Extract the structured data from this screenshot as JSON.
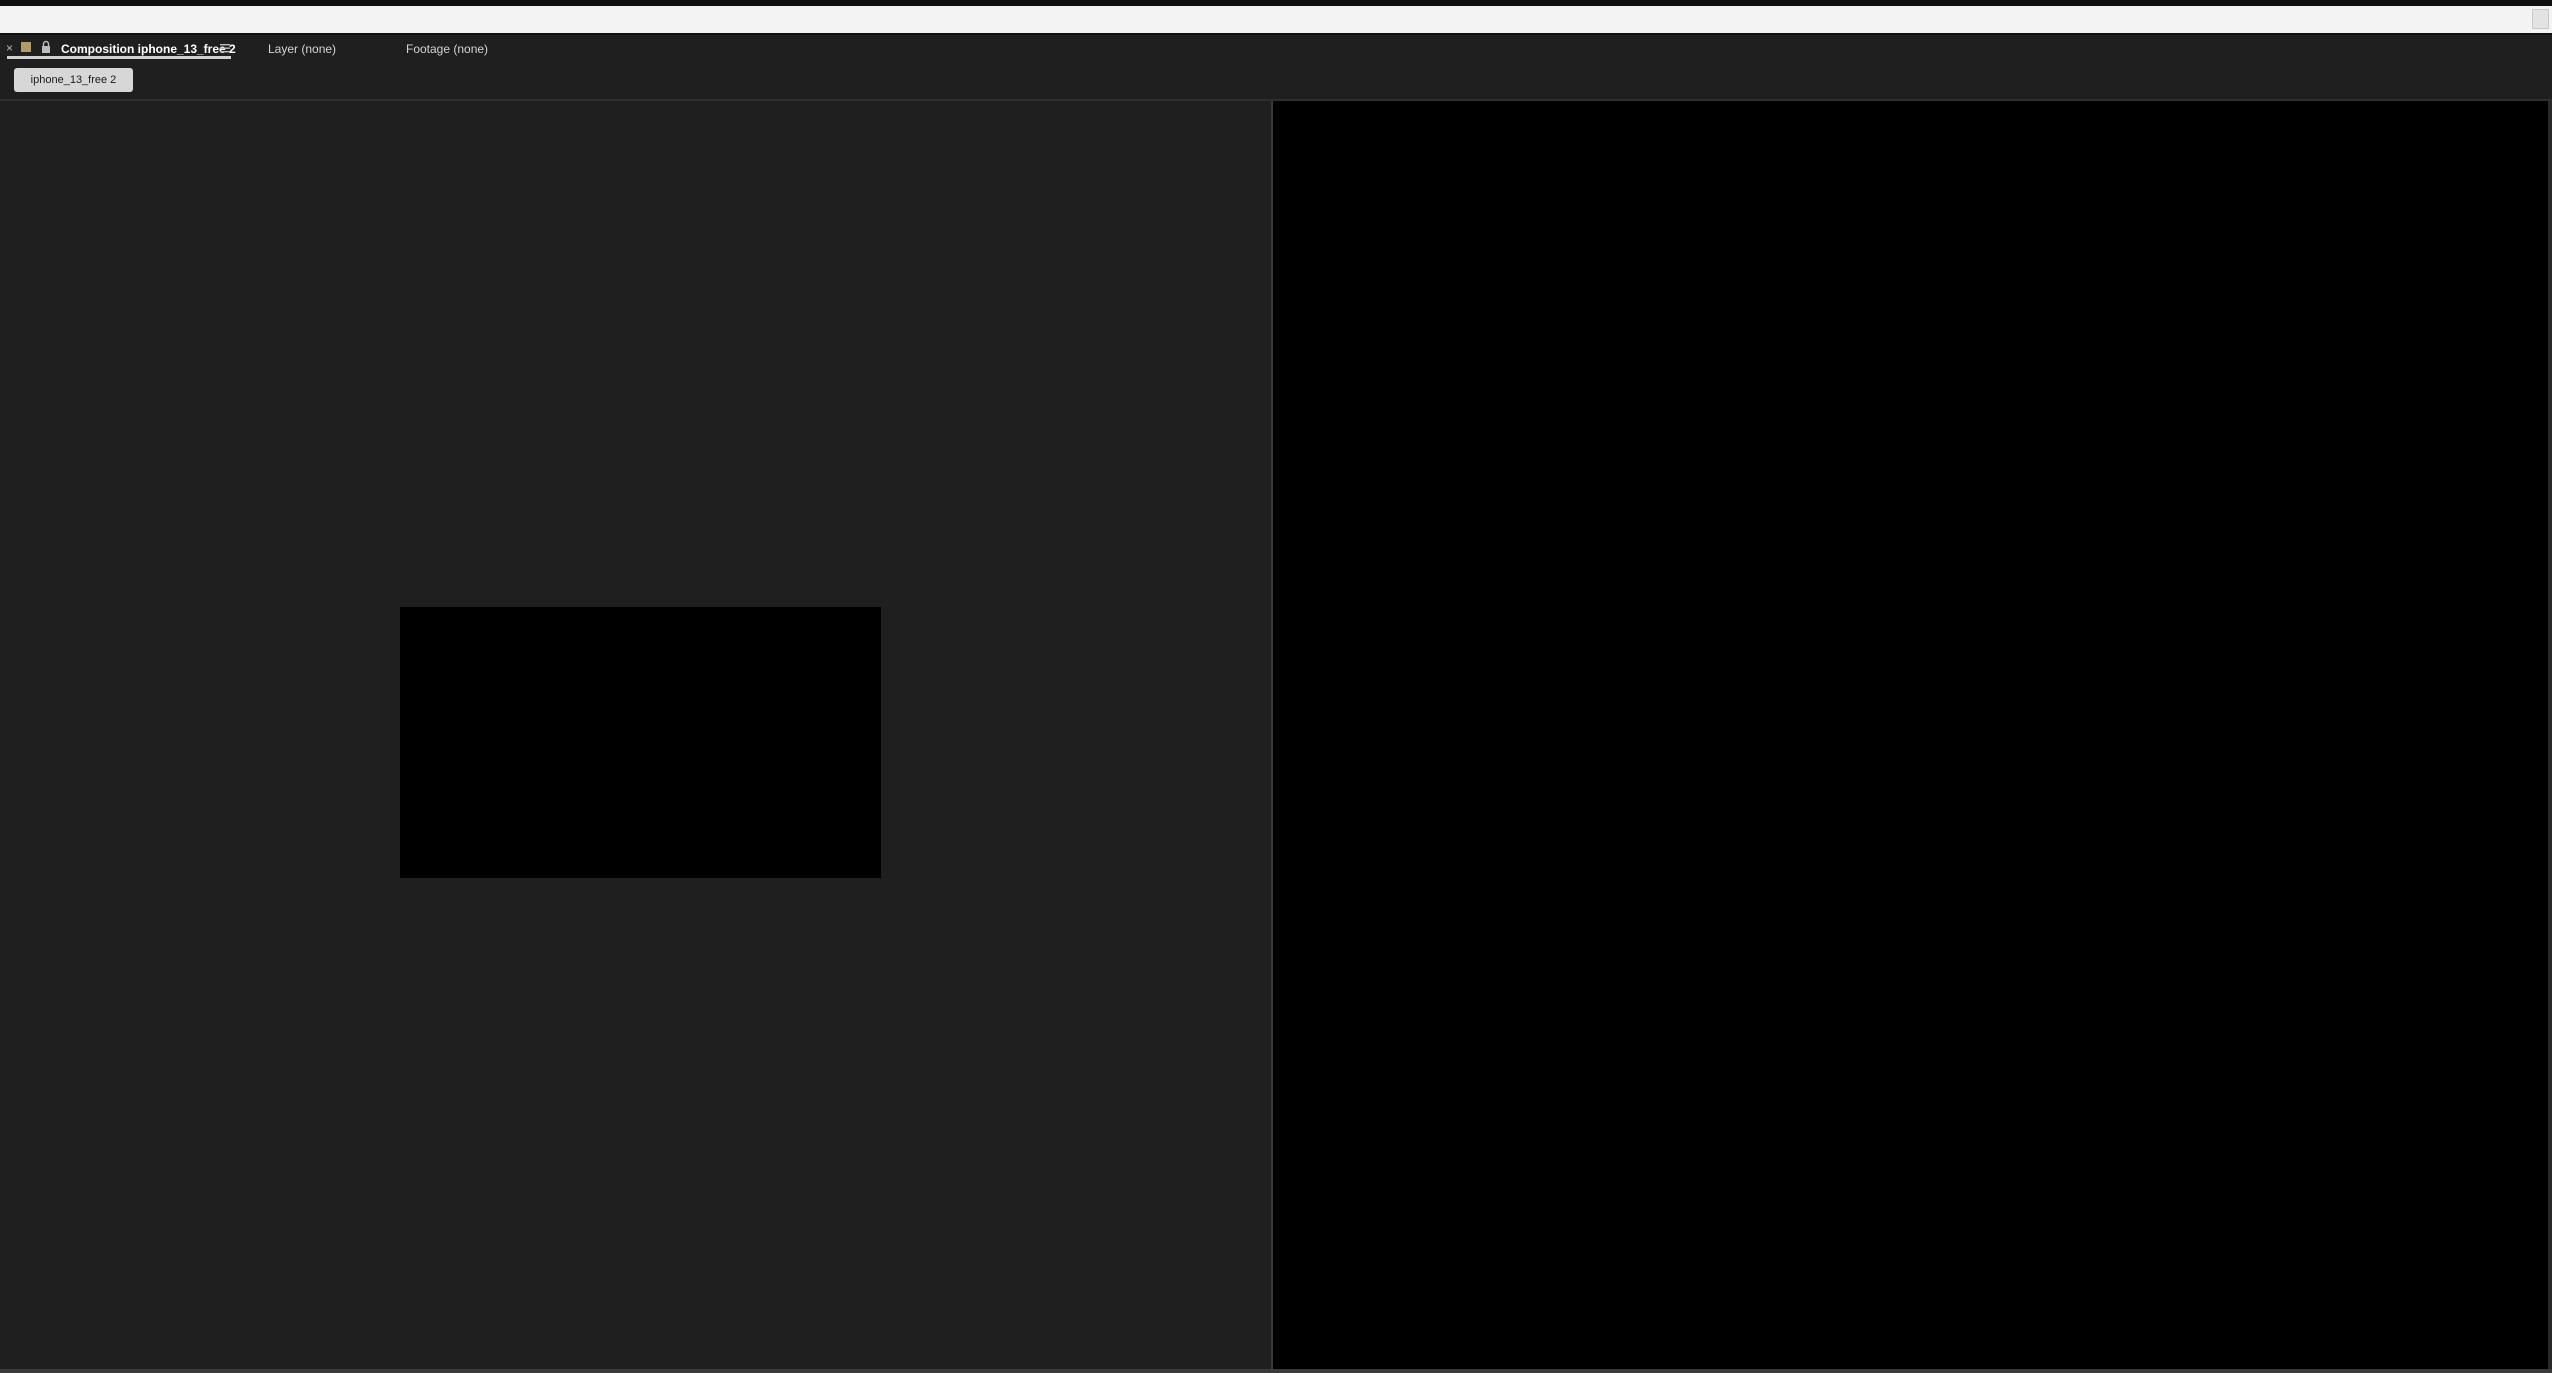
{
  "tabs": {
    "composition": "Composition iphone_13_free 2",
    "layer": "Layer (none)",
    "footage": "Footage (none)"
  },
  "close_label": "×",
  "breadcrumb": "iphone_13_free 2",
  "icons": {
    "close": "close-icon",
    "swatch": "label-color-swatch",
    "lock": "lock-icon",
    "menu": "panel-menu-icon"
  },
  "colors": {
    "panel_bg": "#1f1f1f",
    "viewer_bg": "#000000",
    "label_swatch": "#b49a64",
    "crumb_bg": "#d7d7d7"
  }
}
